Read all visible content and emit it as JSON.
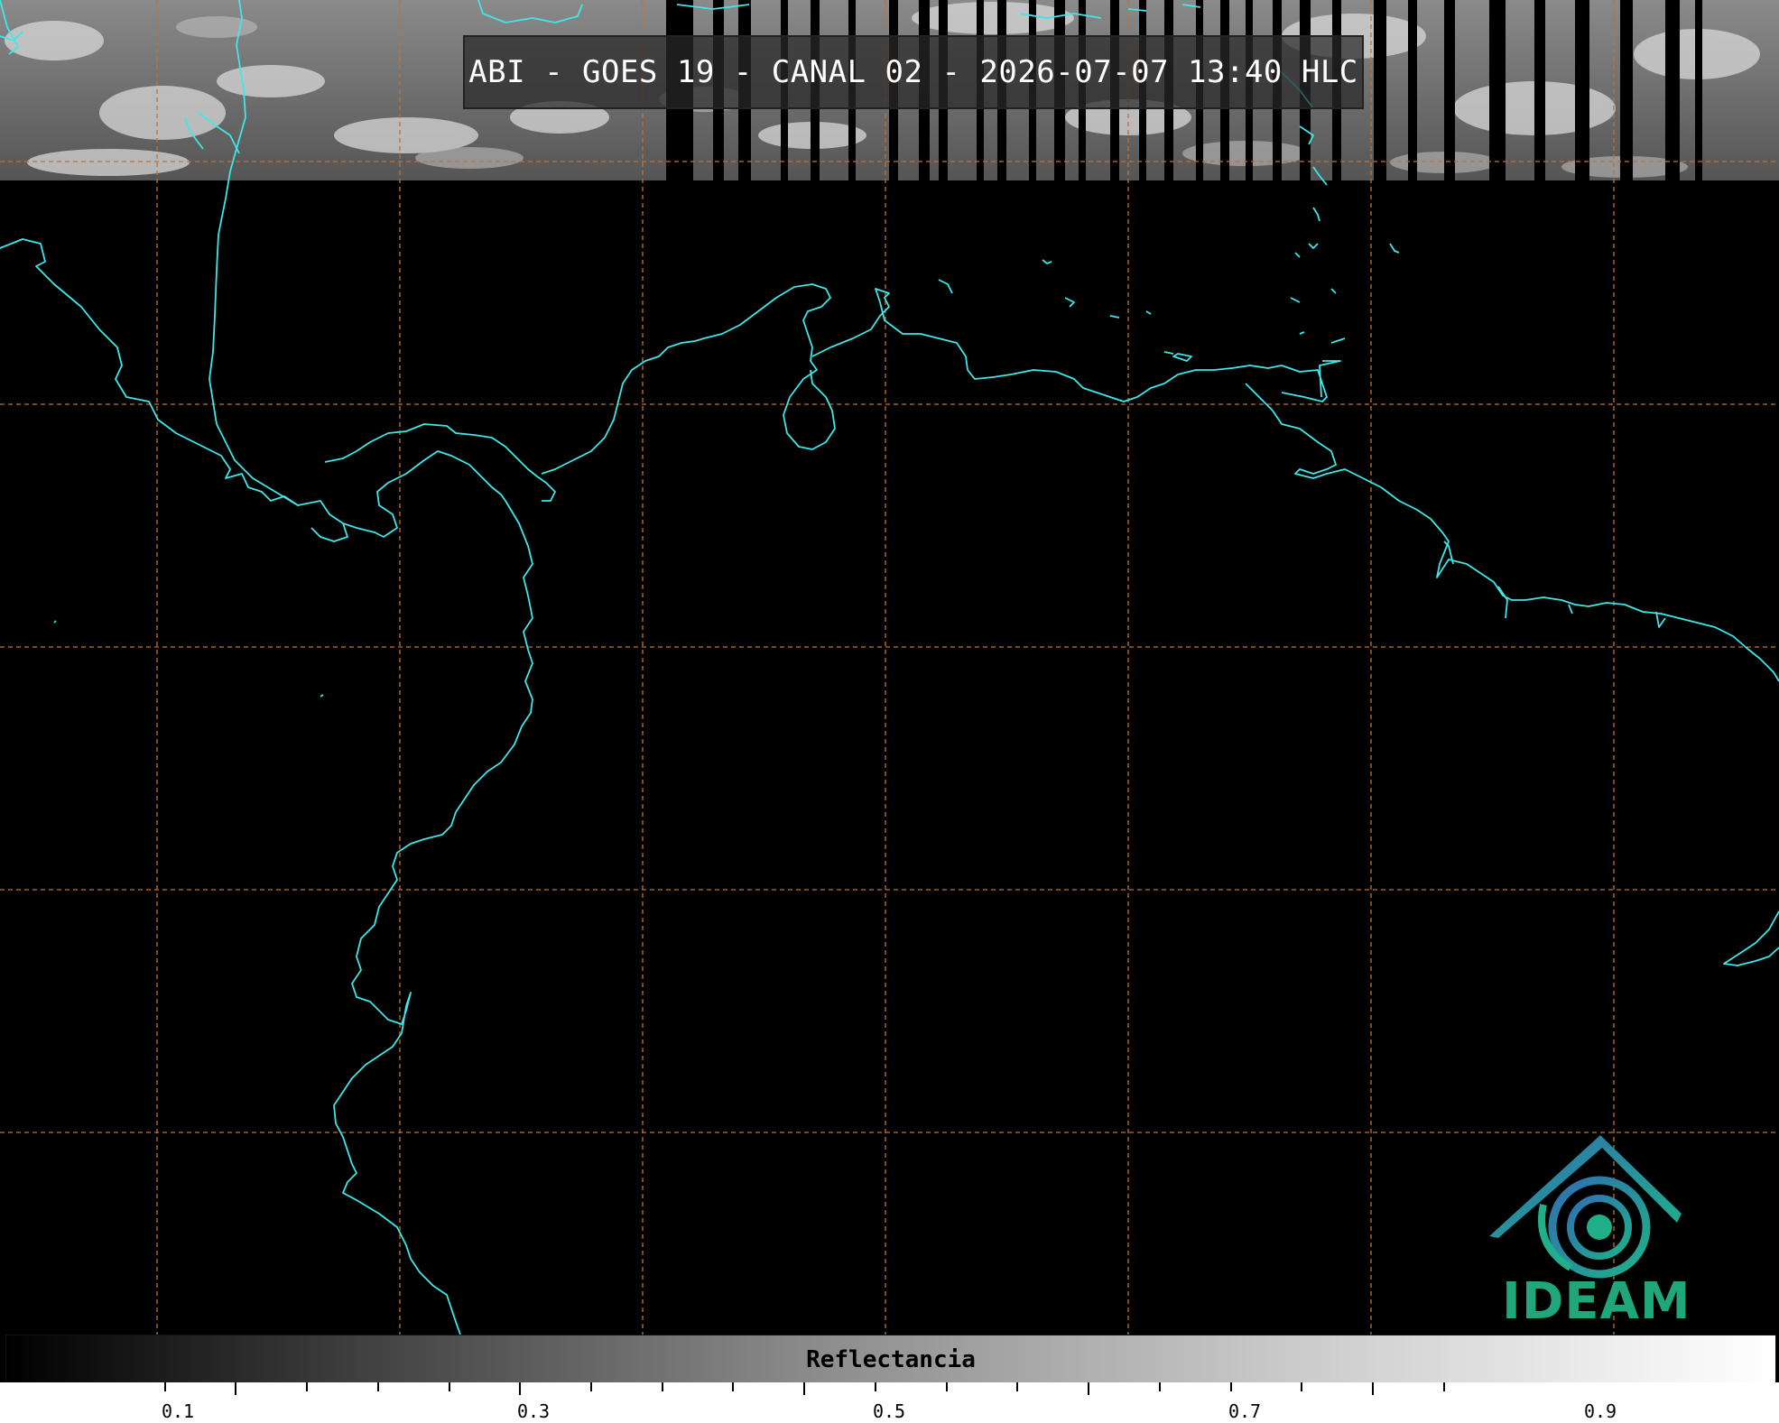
{
  "map": {
    "title": "ABI - GOES 19 - CANAL 02 - 2026-07-07 13:40 HLC",
    "satellite": "GOES 19",
    "instrument": "ABI",
    "channel": "02",
    "datetime": "2026-07-07 13:40 HLC",
    "coastline_color": "#3ee8e8",
    "grid_color": "#c8702a",
    "background_color": "#000000"
  },
  "colorbar": {
    "label": "Reflectancia",
    "ticks": [
      "0.1",
      "0.3",
      "0.5",
      "0.7",
      "0.9"
    ],
    "min": 0.0,
    "max": 1.0
  },
  "logo": {
    "name": "IDEAM",
    "icon": "ideam-logo-icon",
    "text_color": "#1fa67a"
  }
}
